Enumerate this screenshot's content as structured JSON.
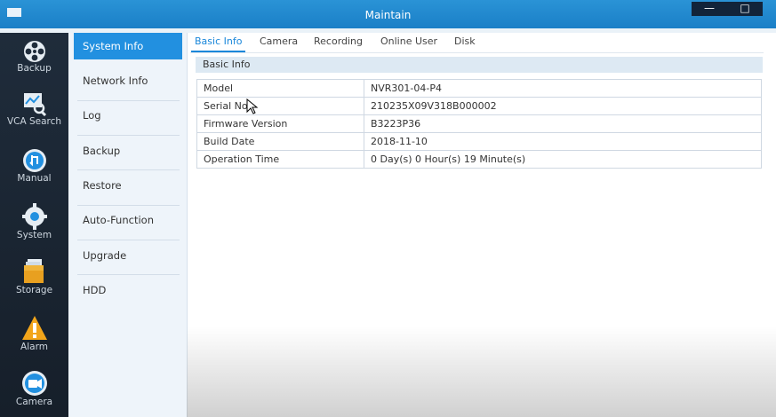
{
  "window": {
    "title": "Maintain",
    "min_label": "—",
    "max_label": "□"
  },
  "leftnav": [
    {
      "label": "Backup",
      "icon": "film-reel-icon"
    },
    {
      "label": "VCA Search",
      "icon": "vca-search-icon"
    },
    {
      "label": "Manual",
      "icon": "manual-record-icon"
    },
    {
      "label": "System",
      "icon": "gear-icon"
    },
    {
      "label": "Storage",
      "icon": "storage-icon"
    },
    {
      "label": "Alarm",
      "icon": "alarm-warning-icon"
    },
    {
      "label": "Camera",
      "icon": "camera-icon"
    }
  ],
  "submenu": [
    {
      "label": "System Info",
      "active": true
    },
    {
      "label": "Network Info"
    },
    {
      "label": "Log"
    },
    {
      "label": "Backup"
    },
    {
      "label": "Restore"
    },
    {
      "label": "Auto-Function"
    },
    {
      "label": "Upgrade"
    },
    {
      "label": "HDD"
    }
  ],
  "tabs": [
    "Basic Info",
    "Camera",
    "Recording",
    "Online User",
    "Disk"
  ],
  "section": {
    "title": "Basic Info"
  },
  "info_rows": [
    {
      "label": "Model",
      "value": "NVR301-04-P4"
    },
    {
      "label": "Serial No.",
      "value": "210235X09V318B000002"
    },
    {
      "label": "Firmware Version",
      "value": "B3223P36"
    },
    {
      "label": "Build Date",
      "value": "2018-11-10"
    },
    {
      "label": "Operation Time",
      "value": "0 Day(s) 0 Hour(s) 19 Minute(s)"
    }
  ],
  "colors": {
    "accent": "#2290e0",
    "titlebar": "#1a87da",
    "nav_bg": "#1b2633"
  }
}
